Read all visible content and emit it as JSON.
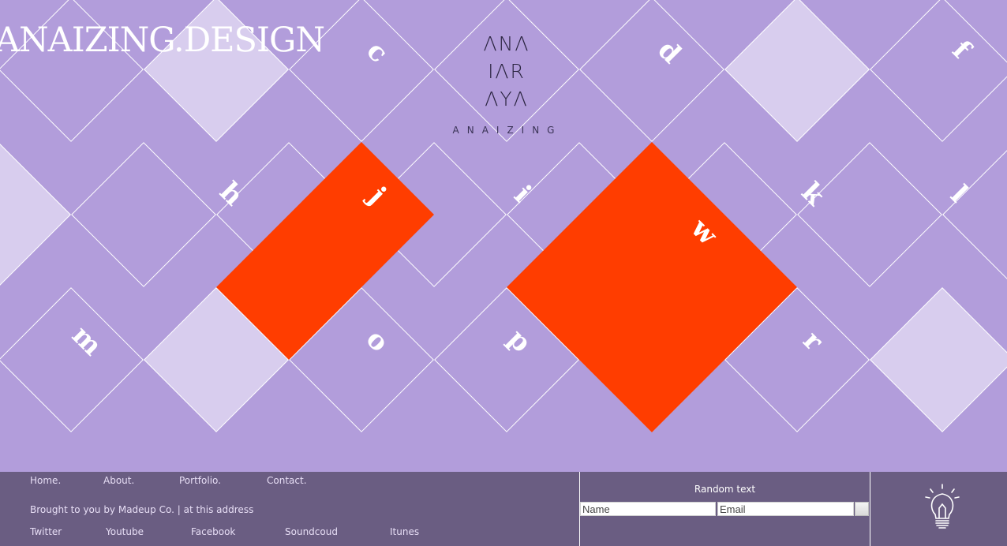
{
  "site": {
    "title": "ANAIZING.DESIGN",
    "logo_lines": [
      "ΛNΛ",
      "IΛR",
      "ΛYΛ"
    ],
    "logo_word": "ANAIZING"
  },
  "colors": {
    "background": "#b29ddb",
    "light_tile": "#d8cdee",
    "accent": "#ff3d00",
    "footer": "#6a5d82",
    "grid_lines": "#ffffff"
  },
  "grid_letters": [
    "c",
    "d",
    "f",
    "h",
    "j",
    "i",
    "w",
    "k",
    "l",
    "m",
    "o",
    "p",
    "r"
  ],
  "footer": {
    "nav": [
      "Home.",
      "About.",
      "Portfolio.",
      "Contact."
    ],
    "credit": "Brought to you by Madeup Co. | at this address",
    "social": [
      "Twitter",
      "Youtube",
      "Facebook",
      "Soundcoud",
      "Itunes"
    ],
    "newsletter": {
      "heading": "Random text",
      "name_placeholder": "Name",
      "email_placeholder": "Email"
    },
    "icon": "lightbulb-icon"
  }
}
